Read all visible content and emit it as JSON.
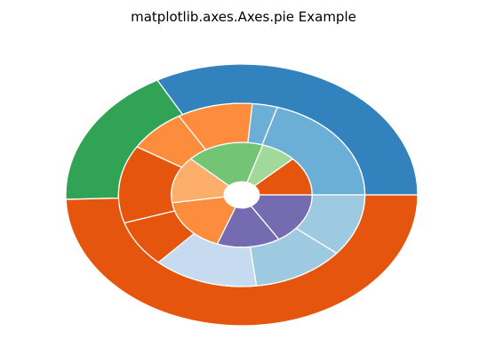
{
  "chart_data": {
    "type": "pie",
    "title": "matplotlib.axes.Axes.pie Example",
    "rings": [
      {
        "name": "outer",
        "values": [
          60,
          32,
          90
        ],
        "colors": [
          "#3182bd",
          "#31a354",
          "#e6550d"
        ]
      },
      {
        "name": "middle",
        "values": [
          37,
          6,
          18,
          14,
          25,
          15,
          25,
          22,
          20
        ],
        "colors": [
          "#6baed6",
          "#6baed6",
          "#fd8d3c",
          "#fd8d3c",
          "#e6550d",
          "#e6550d",
          "#c6dbef",
          "#9ecae1",
          "#9ecae1"
        ]
      },
      {
        "name": "inner",
        "values": [
          15,
          10,
          22,
          18,
          21,
          18,
          20
        ],
        "colors": [
          "#e6550d",
          "#a1d99b",
          "#74c476",
          "#fdae6b",
          "#fd8d3c",
          "#756bb1",
          "#756bb1"
        ]
      }
    ],
    "start_angle_deg": 0,
    "direction": "counterclockwise",
    "wedge_edgecolor": "#ffffff"
  }
}
